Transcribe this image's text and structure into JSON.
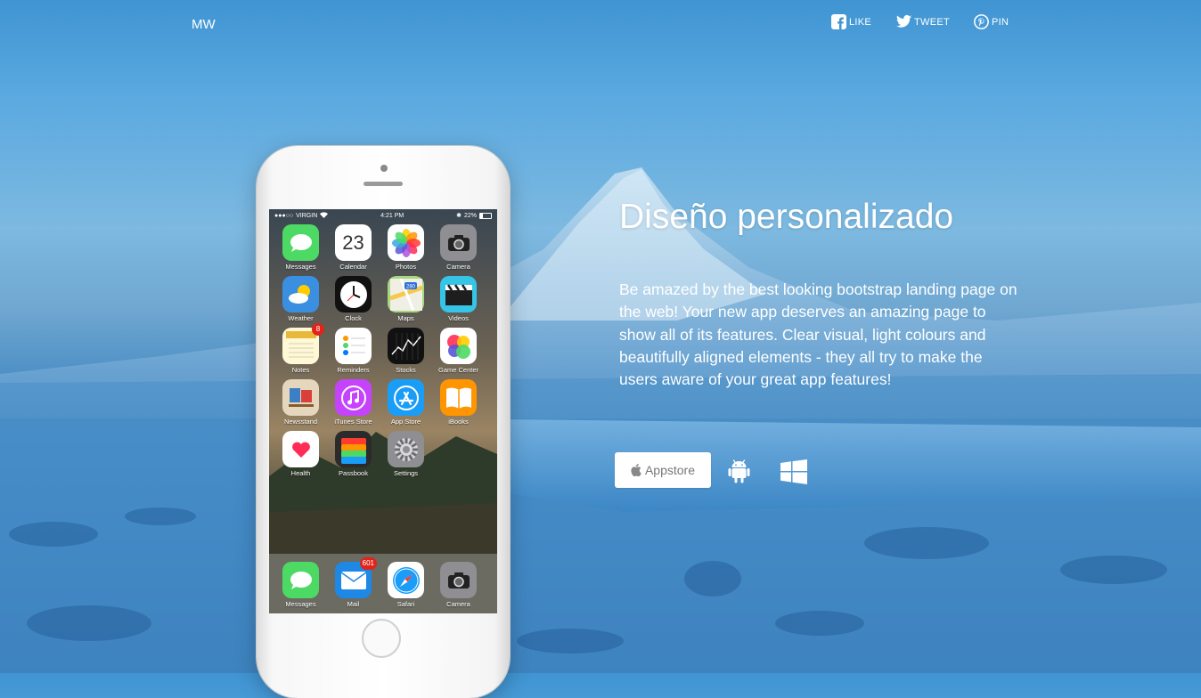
{
  "navbar": {
    "brand": "MW",
    "social": [
      {
        "label": "LIKE",
        "icon": "facebook-icon"
      },
      {
        "label": "TWEET",
        "icon": "twitter-icon"
      },
      {
        "label": "PIN",
        "icon": "pinterest-icon"
      }
    ]
  },
  "hero": {
    "title": "Diseño personalizado",
    "description": "Be amazed by the best looking bootstrap landing page on the web! Your new app deserves an amazing page to show all of its features. Clear visual, light colours and beautifully aligned elements - they all try to make the users aware of your great app features!",
    "buttons": {
      "appstore_label": "Appstore",
      "android_icon": "android-icon",
      "windows_icon": "windows-icon"
    }
  },
  "phone": {
    "status": {
      "carrier": "VIRGIN",
      "time": "4:21 PM",
      "battery": "22%"
    },
    "apps": [
      {
        "label": "Messages",
        "icon": "messages-icon",
        "color": "#4cd964"
      },
      {
        "label": "Calendar",
        "icon": "calendar-icon",
        "color": "#ffffff",
        "text": "23"
      },
      {
        "label": "Photos",
        "icon": "photos-icon",
        "color": "#ffffff"
      },
      {
        "label": "Camera",
        "icon": "camera-icon",
        "color": "#8e8e93"
      },
      {
        "label": "Weather",
        "icon": "weather-icon",
        "color": "#3b8fe0"
      },
      {
        "label": "Clock",
        "icon": "clock-icon",
        "color": "#111111"
      },
      {
        "label": "Maps",
        "icon": "maps-icon",
        "color": "#a8d77f",
        "text": "280"
      },
      {
        "label": "Videos",
        "icon": "videos-icon",
        "color": "#36c5e6"
      },
      {
        "label": "Notes",
        "icon": "notes-icon",
        "color": "#fff8d6",
        "badge": "8"
      },
      {
        "label": "Reminders",
        "icon": "reminders-icon",
        "color": "#ffffff"
      },
      {
        "label": "Stocks",
        "icon": "stocks-icon",
        "color": "#111111"
      },
      {
        "label": "Game Center",
        "icon": "game-center-icon",
        "color": "#ffffff"
      },
      {
        "label": "Newsstand",
        "icon": "newsstand-icon",
        "color": "#e5d7bd"
      },
      {
        "label": "iTunes Store",
        "icon": "itunes-store-icon",
        "color": "#c643fc"
      },
      {
        "label": "App Store",
        "icon": "app-store-icon",
        "color": "#1a9df7"
      },
      {
        "label": "iBooks",
        "icon": "ibooks-icon",
        "color": "#ff9500"
      },
      {
        "label": "Health",
        "icon": "health-icon",
        "color": "#ffffff"
      },
      {
        "label": "Passbook",
        "icon": "passbook-icon",
        "color": "#2b2b2b"
      },
      {
        "label": "Settings",
        "icon": "settings-icon",
        "color": "#8e8e93"
      }
    ],
    "dock": [
      {
        "label": "Messages",
        "icon": "messages-icon",
        "color": "#4cd964"
      },
      {
        "label": "Mail",
        "icon": "mail-icon",
        "color": "#1e88e5",
        "badge": "601"
      },
      {
        "label": "Safari",
        "icon": "safari-icon",
        "color": "#ffffff"
      },
      {
        "label": "Camera",
        "icon": "camera-icon",
        "color": "#8e8e93"
      }
    ]
  }
}
